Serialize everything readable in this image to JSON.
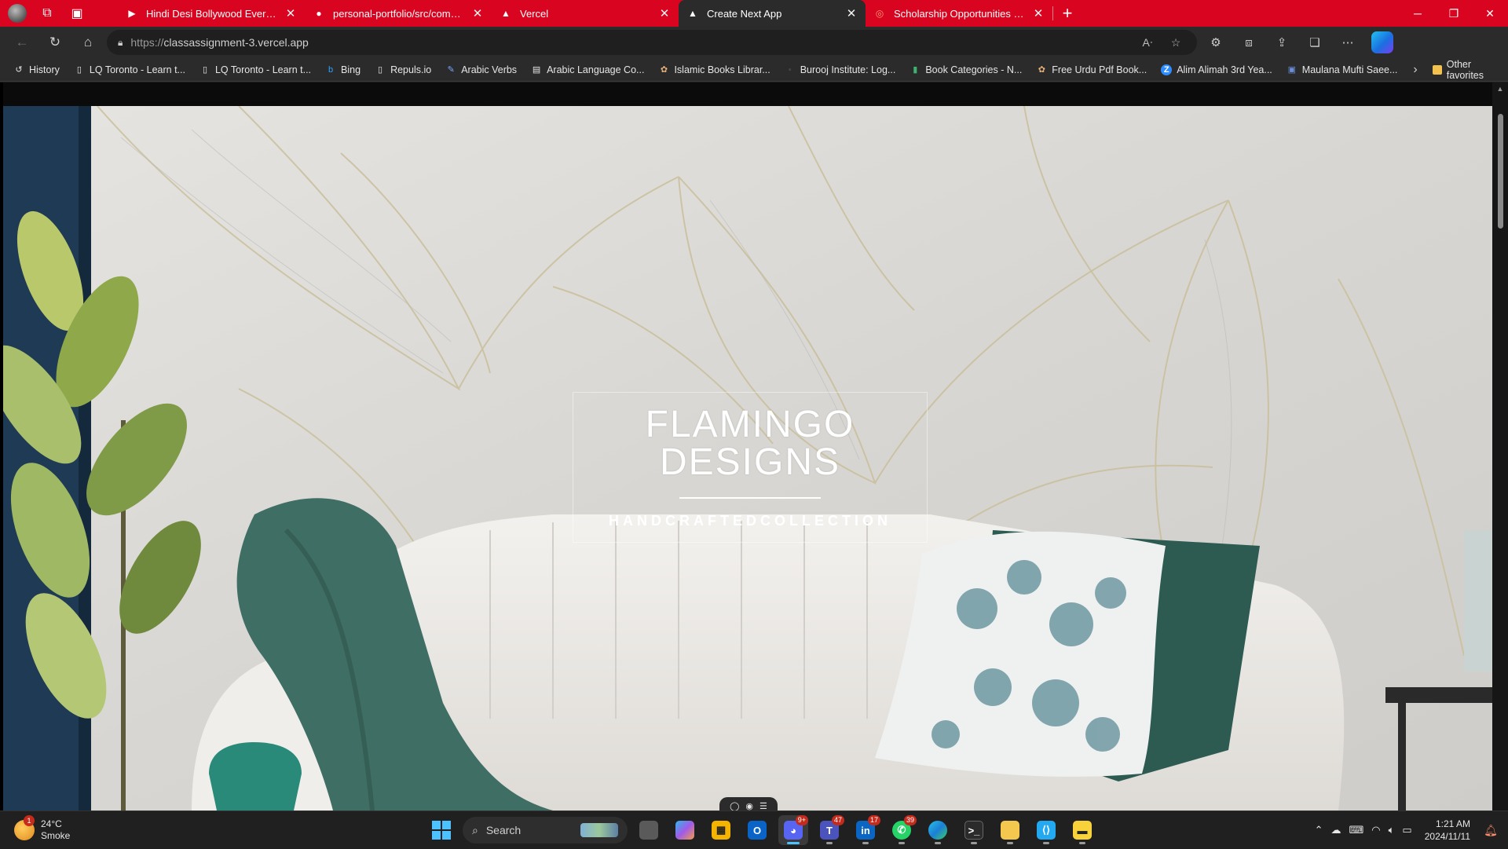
{
  "browser": {
    "tabs": [
      {
        "title": "Hindi Desi Bollywood Evergreen I",
        "favicon": "youtube-icon",
        "active": false
      },
      {
        "title": "personal-portfolio/src/componen",
        "favicon": "github-icon",
        "active": false
      },
      {
        "title": "Vercel",
        "favicon": "vercel-icon",
        "active": false
      },
      {
        "title": "Create Next App",
        "favicon": "vercel-icon",
        "active": true
      },
      {
        "title": "Scholarship Opportunities - Skills",
        "favicon": "scholarship-icon",
        "active": false
      }
    ],
    "address": {
      "scheme": "https://",
      "host": "classassignment-3.vercel.app"
    },
    "accent_color": "#d9041f",
    "favorites": [
      {
        "label": "History",
        "icon": "history-icon"
      },
      {
        "label": "LQ Toronto - Learn t...",
        "icon": "page-icon"
      },
      {
        "label": "LQ Toronto - Learn t...",
        "icon": "page-icon"
      },
      {
        "label": "Bing",
        "icon": "bing-icon"
      },
      {
        "label": "Repuls.io",
        "icon": "page-icon"
      },
      {
        "label": "Arabic Verbs",
        "icon": "arabic-verbs-icon"
      },
      {
        "label": "Arabic Language Co...",
        "icon": "book-icon"
      },
      {
        "label": "Islamic Books Librar...",
        "icon": "library-icon"
      },
      {
        "label": "Burooj Institute: Log...",
        "icon": "burooj-icon"
      },
      {
        "label": "Book Categories - N...",
        "icon": "bookmark-icon"
      },
      {
        "label": "Free Urdu Pdf Book...",
        "icon": "library-icon"
      },
      {
        "label": "Alim Alimah 3rd Yea...",
        "icon": "zoom-icon"
      },
      {
        "label": "Maulana Mufti Saee...",
        "icon": "portrait-icon"
      }
    ],
    "other_favorites": "Other favorites"
  },
  "page": {
    "hero_title_line1": "FLAMINGO",
    "hero_title_line2": "DESIGNS",
    "hero_subtitle": "HANDCRAFTEDCOLLECTION"
  },
  "taskbar": {
    "weather": {
      "temp": "24°C",
      "condition": "Smoke",
      "badge": "1"
    },
    "search_label": "Search",
    "apps": [
      {
        "name": "task-view-icon",
        "badge": ""
      },
      {
        "name": "copilot-app-icon",
        "badge": ""
      },
      {
        "name": "microsoft-store-icon",
        "badge": ""
      },
      {
        "name": "outlook-icon",
        "badge": ""
      },
      {
        "name": "discord-icon",
        "badge": "9+"
      },
      {
        "name": "teams-icon",
        "badge": "47"
      },
      {
        "name": "linkedin-icon",
        "badge": "17"
      },
      {
        "name": "whatsapp-icon",
        "badge": "39"
      },
      {
        "name": "edge-icon",
        "badge": ""
      },
      {
        "name": "terminal-icon",
        "badge": ""
      },
      {
        "name": "file-explorer-icon",
        "badge": ""
      },
      {
        "name": "vscode-icon",
        "badge": ""
      },
      {
        "name": "sticky-notes-icon",
        "badge": ""
      }
    ],
    "time": "1:21 AM",
    "date": "2024/11/11"
  }
}
